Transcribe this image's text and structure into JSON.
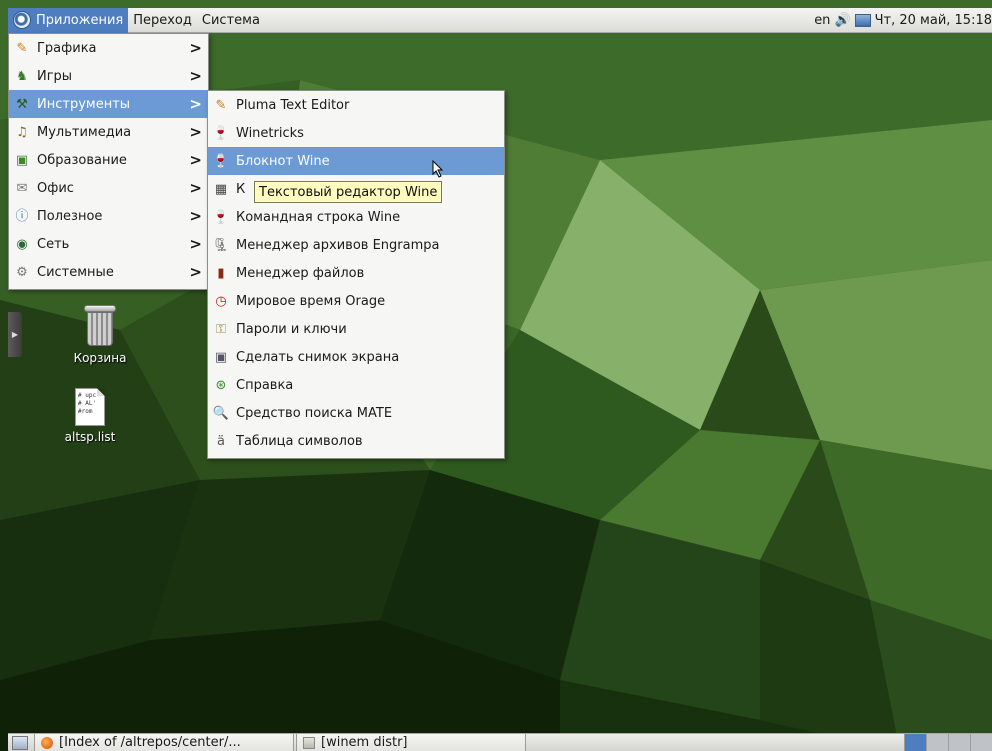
{
  "top_panel": {
    "menus": {
      "applications": "Приложения",
      "places": "Переход",
      "system": "Система"
    },
    "keyboard_layout": "en",
    "clock": "Чт, 20 май, 15:18"
  },
  "applications_menu": {
    "items": [
      {
        "label": "Графика",
        "icon": "graphics-icon"
      },
      {
        "label": "Игры",
        "icon": "games-icon"
      },
      {
        "label": "Инструменты",
        "icon": "tools-icon"
      },
      {
        "label": "Мультимедиа",
        "icon": "multimedia-icon"
      },
      {
        "label": "Образование",
        "icon": "education-icon"
      },
      {
        "label": "Офис",
        "icon": "office-icon"
      },
      {
        "label": "Полезное",
        "icon": "accessories-icon"
      },
      {
        "label": "Сеть",
        "icon": "network-icon"
      },
      {
        "label": "Системные",
        "icon": "system-icon"
      }
    ],
    "arrow": ">"
  },
  "tools_submenu": {
    "items": [
      {
        "label": "Pluma Text Editor",
        "icon": "text-editor-icon"
      },
      {
        "label": "Winetricks",
        "icon": "winetricks-icon"
      },
      {
        "label": "Блокнот Wine",
        "icon": "wine-notepad-icon"
      },
      {
        "label": "К",
        "icon": "calculator-icon"
      },
      {
        "label": "Командная строка Wine",
        "icon": "wine-cmd-icon"
      },
      {
        "label": "Менеджер архивов Engrampa",
        "icon": "archive-manager-icon"
      },
      {
        "label": "Менеджер файлов",
        "icon": "file-manager-icon"
      },
      {
        "label": "Мировое время Orage",
        "icon": "world-clock-icon"
      },
      {
        "label": "Пароли и ключи",
        "icon": "keys-icon"
      },
      {
        "label": "Сделать снимок экрана",
        "icon": "screenshot-icon"
      },
      {
        "label": "Справка",
        "icon": "help-icon"
      },
      {
        "label": "Средство поиска MATE",
        "icon": "search-icon"
      },
      {
        "label": "Таблица символов",
        "icon": "charmap-icon"
      }
    ]
  },
  "tooltip": "Текстовый редактор Wine",
  "desktop_icons": {
    "trash": "Корзина",
    "file": "altsp.list",
    "file_preview": [
      "# upc",
      "",
      "# AL'",
      "#rom"
    ]
  },
  "taskbar": {
    "tasks": [
      {
        "label": "[Index of /altrepos/center/..."
      },
      {
        "label": "[winem distr]"
      }
    ]
  },
  "colors": {
    "menu_highlight": "#6b9ad4",
    "panel_active": "#4e7ec0",
    "tooltip_bg": "#fdfbbd"
  }
}
